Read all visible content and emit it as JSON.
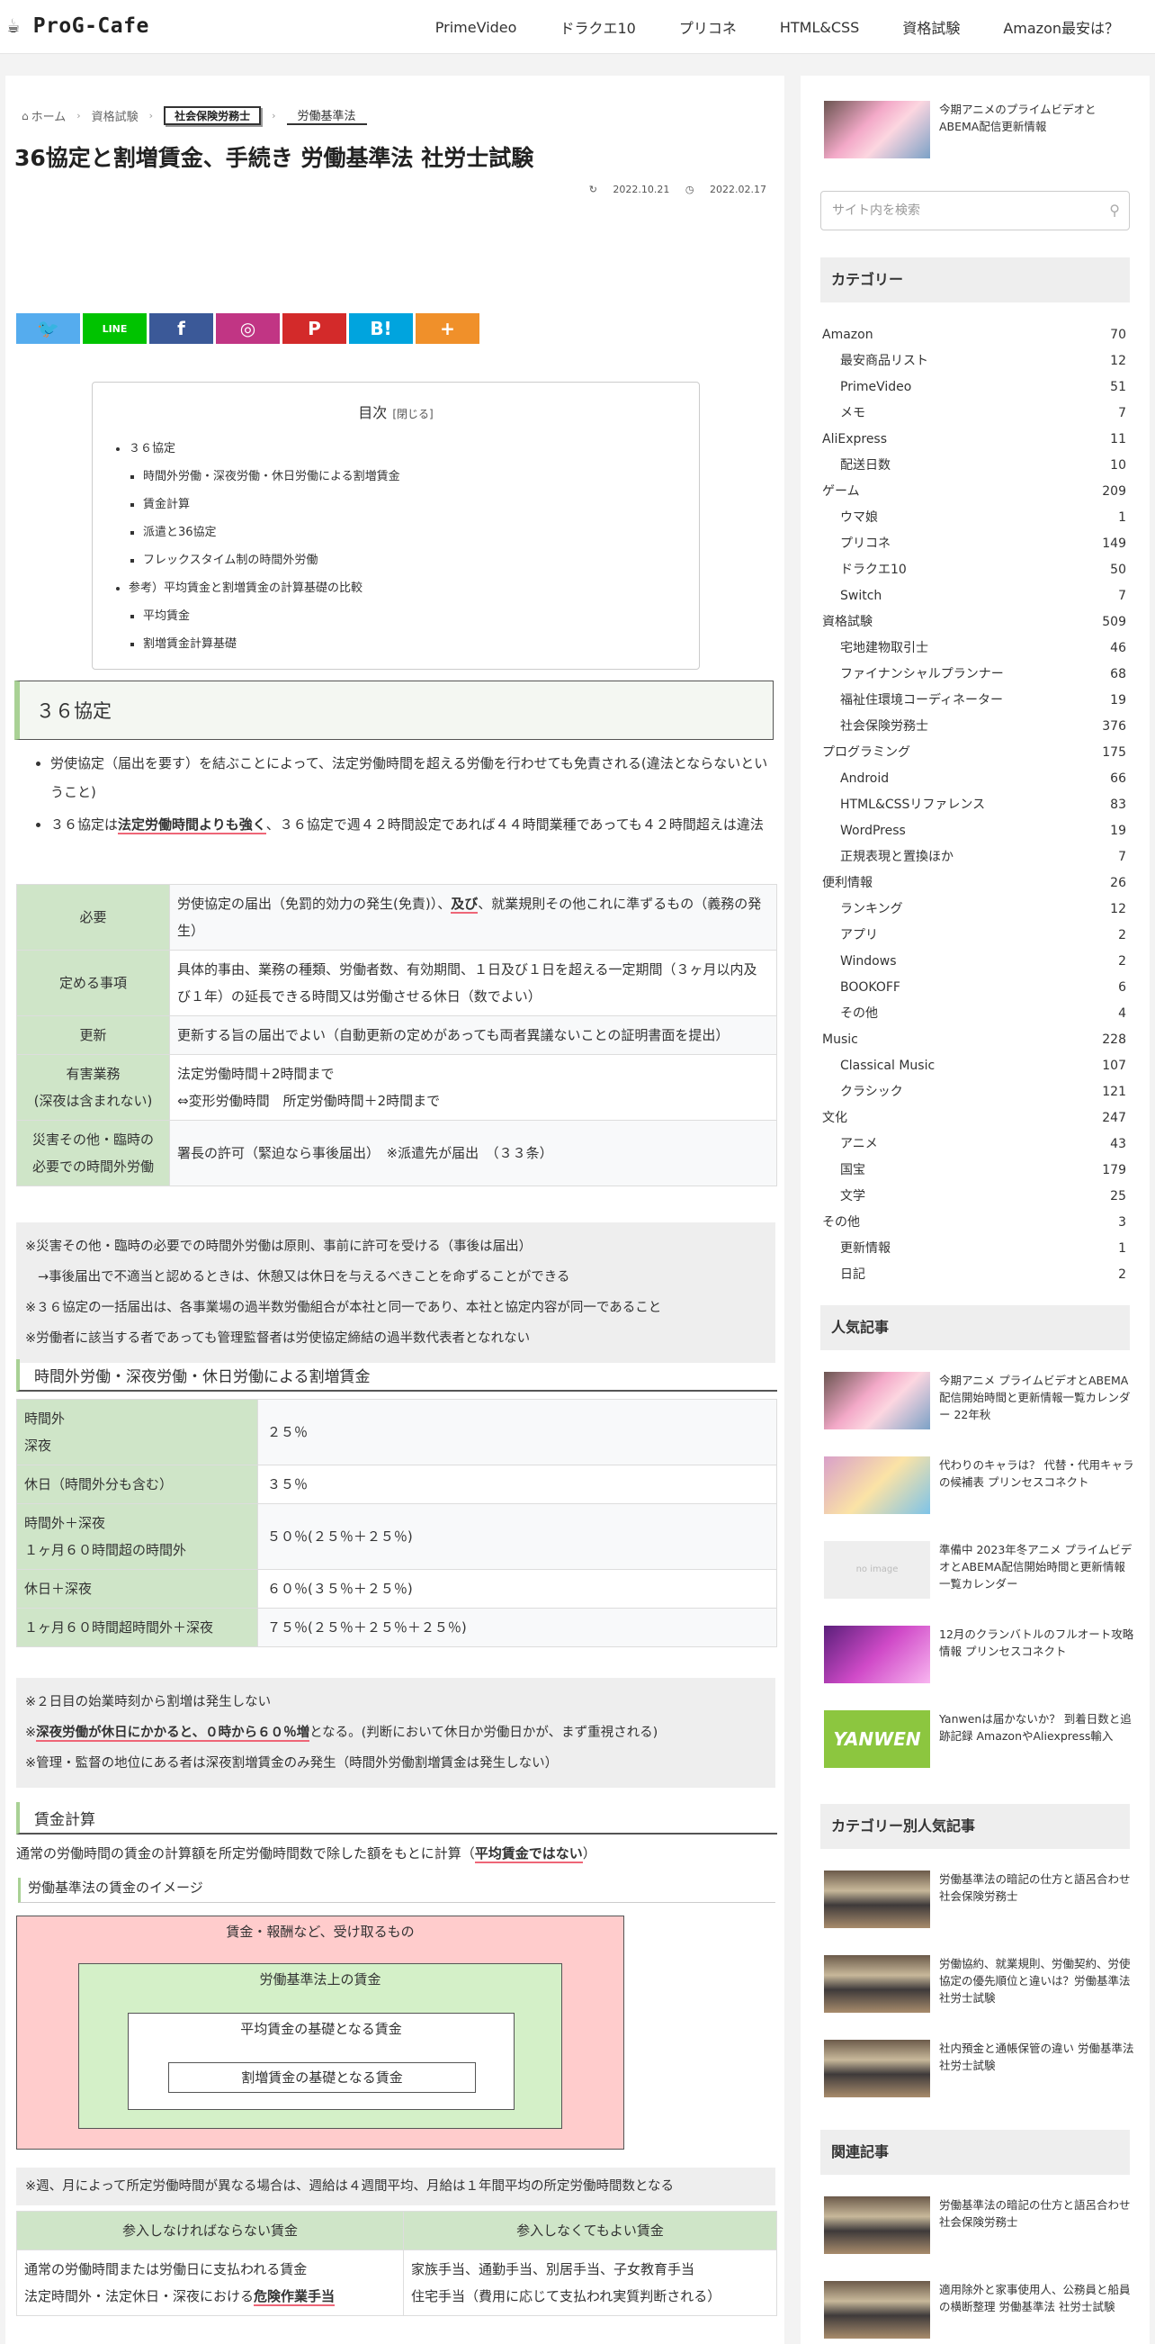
{
  "header": {
    "logo": "☕ ProG-Cafe",
    "nav": [
      "PrimeVideo",
      "ドラクエ10",
      "プリコネ",
      "HTML&CSS",
      "資格試験",
      "Amazon最安は？"
    ]
  },
  "breadcrumb": [
    "ホーム",
    "資格試験",
    "社会保険労務士",
    "労働基準法"
  ],
  "title": "36協定と割増賃金、手続き 労働基準法 社労士試験",
  "dates": {
    "updated": "2022.10.21",
    "published": "2022.02.17"
  },
  "share": [
    {
      "icon": "twitter-icon",
      "color": "#55acee",
      "glyph": "🐦"
    },
    {
      "icon": "line-icon",
      "color": "#00c300",
      "glyph": "LINE"
    },
    {
      "icon": "facebook-icon",
      "color": "#3b5998",
      "glyph": "f"
    },
    {
      "icon": "instagram-icon",
      "color": "#c13584",
      "glyph": "◎"
    },
    {
      "icon": "pinterest-icon",
      "color": "#d32a2a",
      "glyph": "P"
    },
    {
      "icon": "hatena-icon",
      "color": "#00a4de",
      "glyph": "B!"
    },
    {
      "icon": "more-icon",
      "color": "#f0902a",
      "glyph": "+"
    }
  ],
  "toc": {
    "title": "目次",
    "toggle": "[閉じる]",
    "items": [
      {
        "t": "３６協定",
        "sub": false
      },
      {
        "t": "時間外労働・深夜労働・休日労働による割増賃金",
        "sub": true
      },
      {
        "t": "賃金計算",
        "sub": true
      },
      {
        "t": "派遣と36協定",
        "sub": true
      },
      {
        "t": "フレックスタイム制の時間外労働",
        "sub": true
      },
      {
        "t": "参考）平均賃金と割増賃金の計算基礎の比較",
        "sub": false
      },
      {
        "t": "平均賃金",
        "sub": true
      },
      {
        "t": "割増賃金計算基礎",
        "sub": true
      }
    ]
  },
  "section1": {
    "heading": "３６協定",
    "b1": "労使協定（届出を要す）を結ぶことによって、法定労働時間を超える労働を行わせても免責される(違法とならないということ)",
    "b2a": "３６協定は",
    "b2m": "法定労働時間よりも強く",
    "b2b": "、３６協定で週４２時間設定であれば４４時間業種であっても４２時間超えは違法"
  },
  "table1": [
    {
      "h": "必要",
      "v1": "労使協定の届出（免罰的効力の発生(免責)）、",
      "vm": "及び",
      "v2": "、就業規則その他これに準ずるもの（義務の発生）"
    },
    {
      "h": "定める事項",
      "v1": "具体的事由、業務の種類、労働者数、有効期間、１日及び１日を超える一定期間（３ヶ月以内及び１年）の延長できる時間又は労働させる休日（数でよい）"
    },
    {
      "h": "更新",
      "v1": "更新する旨の届出でよい（自動更新の定めがあっても両者異議ないことの証明書面を提出）"
    },
    {
      "h": "有害業務\n(深夜は含まれない)",
      "v1": "法定労働時間＋2時間まで\n⇔変形労働時間　所定労働時間＋2時間まで"
    },
    {
      "h": "災害その他・臨時の\n必要での時間外労働",
      "v1": "署長の許可（緊迫なら事後届出）　※派遣先が届出　（３３条）"
    }
  ],
  "note1": [
    "※災害その他・臨時の必要での時間外労働は原則、事前に許可を受ける（事後は届出）",
    "→事後届出で不適当と認めるときは、休憩又は休日を与えるべきことを命ずることができる",
    "※３６協定の一括届出は、各事業場の過半数労働組合が本社と同一であり、本社と協定内容が同一であること",
    "※労働者に該当する者であっても管理監督者は労使協定締結の過半数代表者となれない"
  ],
  "h3a": "時間外労働・深夜労働・休日労働による割増賃金",
  "table2": [
    {
      "k": "時間外\n深夜",
      "v": "２５％"
    },
    {
      "k": "休日（時間外分も含む）",
      "v": "３５％"
    },
    {
      "k": "時間外＋深夜\n１ヶ月６０時間超の時間外",
      "v": "５０％(２５％＋２５％)"
    },
    {
      "k": "休日＋深夜",
      "v": "６０％(３５％＋２５％)"
    },
    {
      "k": "１ヶ月６０時間超時間外＋深夜",
      "v": "７５％(２５％＋２５％＋２５％)"
    }
  ],
  "note2": {
    "l1": "※２日目の始業時刻から割増は発生しない",
    "l2a": "※",
    "l2m": "深夜労働が休日にかかると、０時から６０％増",
    "l2b": "となる。(判断において休日か労働日かが、まず重視される)",
    "l3": "※管理・監督の地位にある者は深夜割増賃金のみ発生（時間外労働割増賃金は発生しない）"
  },
  "h3b": "賃金計算",
  "para1a": "通常の労働時間の賃金の計算額を所定労働時間数で除した額をもとに計算（",
  "para1m": "平均賃金ではない",
  "para1b": "）",
  "h4": "労働基準法の賃金のイメージ",
  "diagram": [
    "賃金・報酬など、受け取るもの",
    "労働基準法上の賃金",
    "平均賃金の基礎となる賃金",
    "割増賃金の基礎となる賃金"
  ],
  "note3": "※週、月によって所定労働時間が異なる場合は、週給は４週間平均、月給は１年間平均の所定労働時間数となる",
  "table3": {
    "h1": "参入しなければならない賃金",
    "h2": "参入しなくてもよい賃金",
    "c1a": "通常の労働時間または労働日に支払われる賃金",
    "c1b": "法定時間外・法定休日・深夜における",
    "c1m": "危険作業手当",
    "c2a": "家族手当、通勤手当、別居手当、子女教育手当",
    "c2b": "住宅手当（費用に応じて支払われ実質判断される）"
  },
  "sidebar": {
    "top_post": "今期アニメのプライムビデオとABEMA配信更新情報",
    "search_placeholder": "サイト内を検索",
    "categories_title": "カテゴリー",
    "categories": [
      {
        "n": "Amazon",
        "c": "70",
        "sub": false
      },
      {
        "n": "最安商品リスト",
        "c": "12",
        "sub": true
      },
      {
        "n": "PrimeVideo",
        "c": "51",
        "sub": true
      },
      {
        "n": "メモ",
        "c": "7",
        "sub": true
      },
      {
        "n": "AliExpress",
        "c": "11",
        "sub": false
      },
      {
        "n": "配送日数",
        "c": "10",
        "sub": true
      },
      {
        "n": "ゲーム",
        "c": "209",
        "sub": false
      },
      {
        "n": "ウマ娘",
        "c": "1",
        "sub": true
      },
      {
        "n": "プリコネ",
        "c": "149",
        "sub": true
      },
      {
        "n": "ドラクエ10",
        "c": "50",
        "sub": true
      },
      {
        "n": "Switch",
        "c": "7",
        "sub": true
      },
      {
        "n": "資格試験",
        "c": "509",
        "sub": false
      },
      {
        "n": "宅地建物取引士",
        "c": "46",
        "sub": true
      },
      {
        "n": "ファイナンシャルプランナー",
        "c": "68",
        "sub": true
      },
      {
        "n": "福祉住環境コーディネーター",
        "c": "19",
        "sub": true
      },
      {
        "n": "社会保険労務士",
        "c": "376",
        "sub": true
      },
      {
        "n": "プログラミング",
        "c": "175",
        "sub": false
      },
      {
        "n": "Android",
        "c": "66",
        "sub": true
      },
      {
        "n": "HTML&CSSリファレンス",
        "c": "83",
        "sub": true
      },
      {
        "n": "WordPress",
        "c": "19",
        "sub": true
      },
      {
        "n": "正規表現と置換ほか",
        "c": "7",
        "sub": true
      },
      {
        "n": "便利情報",
        "c": "26",
        "sub": false
      },
      {
        "n": "ランキング",
        "c": "12",
        "sub": true
      },
      {
        "n": "アプリ",
        "c": "2",
        "sub": true
      },
      {
        "n": "Windows",
        "c": "2",
        "sub": true
      },
      {
        "n": "BOOKOFF",
        "c": "6",
        "sub": true
      },
      {
        "n": "その他",
        "c": "4",
        "sub": true
      },
      {
        "n": "Music",
        "c": "228",
        "sub": false
      },
      {
        "n": "Classical Music",
        "c": "107",
        "sub": true
      },
      {
        "n": "クラシック",
        "c": "121",
        "sub": true
      },
      {
        "n": "文化",
        "c": "247",
        "sub": false
      },
      {
        "n": "アニメ",
        "c": "43",
        "sub": true
      },
      {
        "n": "国宝",
        "c": "179",
        "sub": true
      },
      {
        "n": "文学",
        "c": "25",
        "sub": true
      },
      {
        "n": "その他",
        "c": "3",
        "sub": false
      },
      {
        "n": "更新情報",
        "c": "1",
        "sub": true
      },
      {
        "n": "日記",
        "c": "2",
        "sub": true
      }
    ],
    "popular_title": "人気記事",
    "popular": [
      {
        "t": "今期アニメ プライムビデオとABEMA配信開始時間と更新情報一覧カレンダー 22年秋",
        "thumb": "anime"
      },
      {
        "t": "代わりのキャラは？ 代替・代用キャラの候補表 プリンセスコネクト",
        "thumb": "game"
      },
      {
        "t": "準備中 2023年冬アニメ プライムビデオとABEMA配信開始時間と更新情報一覧カレンダー",
        "thumb": "noimage"
      },
      {
        "t": "12月のクランバトルのフルオート攻略情報 プリンセスコネクト",
        "thumb": "purple"
      },
      {
        "t": "Yanwenは届かないか？ 到着日数と追跡記録 AmazonやAliexpress輸入",
        "thumb": "yanwen"
      }
    ],
    "cat_popular_title": "カテゴリー別人気記事",
    "cat_popular": [
      "労働基準法の暗記の仕方と語呂合わせ 社会保険労務士",
      "労働協約、就業規則、労働契約、労使協定の優先順位と違いは？労働基準法 社労士試験",
      "社内預金と通帳保管の違い 労働基準法 社労士試験"
    ],
    "related_title": "関連記事",
    "related": [
      "労働基準法の暗記の仕方と語呂合わせ 社会保険労務士",
      "適用除外と家事使用人、公務員と船員の横断整理 労働基準法 社労士試験"
    ],
    "noimage": "no image",
    "yanwen": "YANWEN"
  }
}
